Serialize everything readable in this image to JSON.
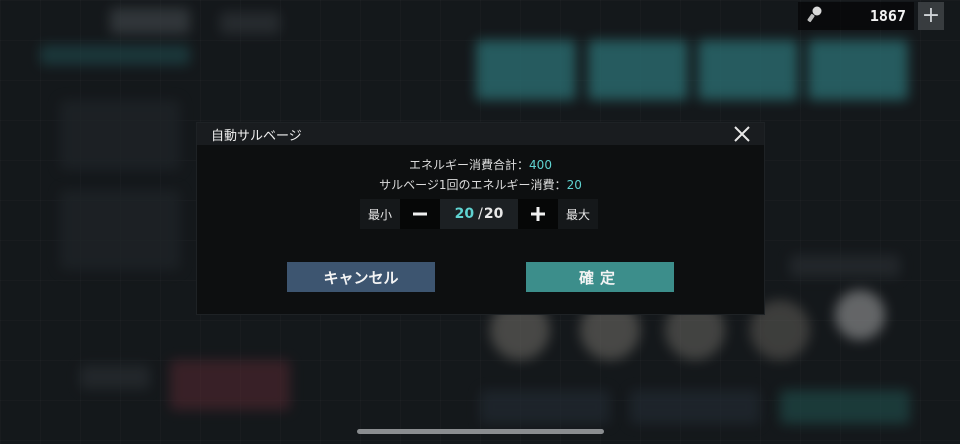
{
  "currency": {
    "amount": "1867",
    "icon": "energy-mic-icon",
    "add_icon": "plus-icon"
  },
  "dialog": {
    "title": "自動サルベージ",
    "info": {
      "total_label": "エネルギー消費合計：",
      "total_value": "400",
      "per_label": "サルベージ1回のエネルギー消費：",
      "per_value": "20"
    },
    "stepper": {
      "min_label": "最小",
      "max_label": "最大",
      "current": "20",
      "separator": "/",
      "max_value": "20"
    },
    "cancel_label": "キャンセル",
    "confirm_label": "確定"
  },
  "colors": {
    "accent": "#5fd3d1",
    "cancel_button": "#3d5570",
    "confirm_button": "#3c8e8b"
  }
}
